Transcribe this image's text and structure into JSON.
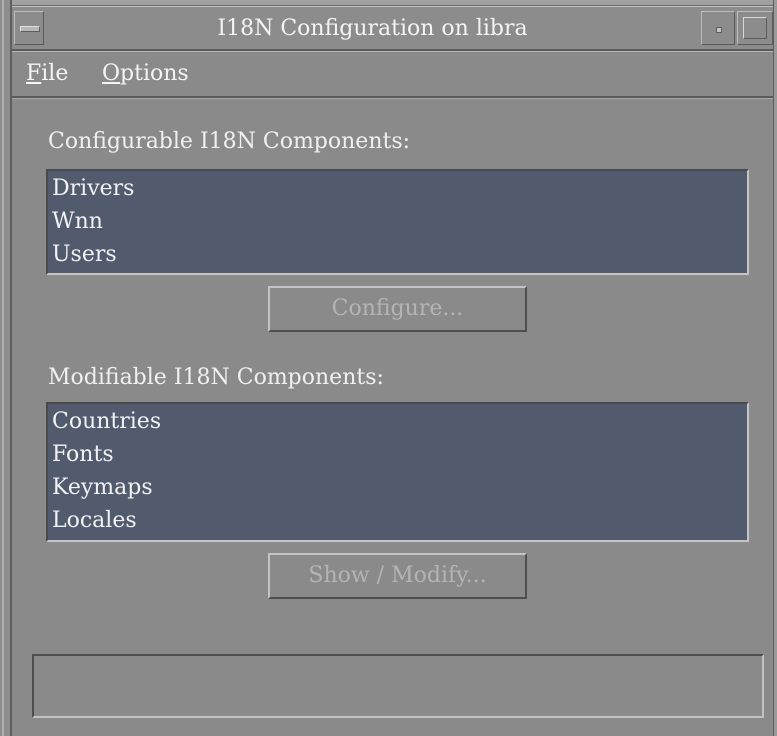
{
  "window": {
    "title": "I18N Configuration on libra"
  },
  "menubar": {
    "items": [
      {
        "label": "File",
        "mnemonic": "F",
        "rest": "ile"
      },
      {
        "label": "Options",
        "mnemonic": "O",
        "rest": "ptions"
      }
    ]
  },
  "configurable": {
    "label": "Configurable I18N Components:",
    "items": [
      "Drivers",
      "Wnn",
      "Users"
    ],
    "button_label": "Configure...",
    "button_enabled": false
  },
  "modifiable": {
    "label": "Modifiable I18N Components:",
    "items": [
      "Countries",
      "Fonts",
      "Keymaps",
      "Locales"
    ],
    "button_label": "Show / Modify...",
    "button_enabled": false
  },
  "status": {
    "text": ""
  },
  "colors": {
    "window_bg": "#8a8a8a",
    "list_bg": "#525a6e",
    "text": "#f2f2f2",
    "disabled_text": "#b4b4b4"
  },
  "icons": {
    "window_menu": "window-menu-icon",
    "minimize": "minimize-icon",
    "maximize": "maximize-icon"
  }
}
